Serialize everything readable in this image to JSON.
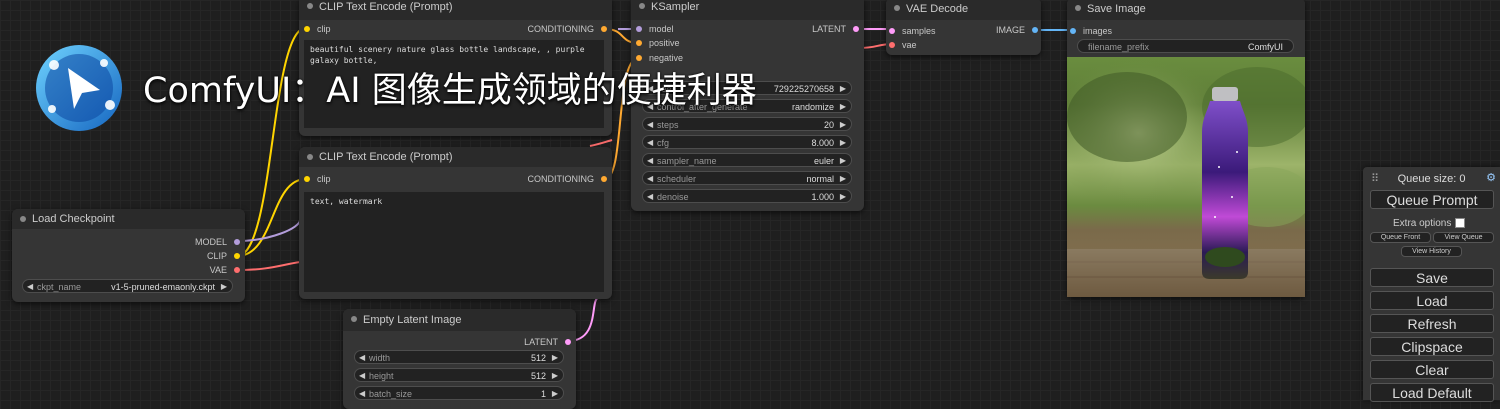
{
  "title": "ComfyUI：AI 图像生成领域的便捷利器",
  "colors": {
    "clip": "#ffd500",
    "model": "#b39ddb",
    "vae": "#ff6e6e",
    "conditioning": "#ffa931",
    "latent": "#ff9cf9",
    "image": "#64b5f6",
    "canvas": "#1f1f1f"
  },
  "nodes": {
    "load_checkpoint": {
      "title": "Load Checkpoint",
      "outputs": [
        "MODEL",
        "CLIP",
        "VAE"
      ],
      "ckpt_label": "ckpt_name",
      "ckpt_value": "v1-5-pruned-emaonly.ckpt"
    },
    "clip_pos": {
      "title": "CLIP Text Encode (Prompt)",
      "input": "clip",
      "output": "CONDITIONING",
      "text": "beautiful scenery nature glass bottle landscape, , purple galaxy bottle,"
    },
    "clip_neg": {
      "title": "CLIP Text Encode (Prompt)",
      "input": "clip",
      "output": "CONDITIONING",
      "text": "text, watermark"
    },
    "ksampler": {
      "title": "KSampler",
      "inputs": [
        "model",
        "positive",
        "negative"
      ],
      "output": "LATENT",
      "widgets": [
        {
          "label": "seed",
          "value": "729225270658"
        },
        {
          "label": "control_after_generate",
          "value": "randomize"
        },
        {
          "label": "steps",
          "value": "20"
        },
        {
          "label": "cfg",
          "value": "8.000"
        },
        {
          "label": "sampler_name",
          "value": "euler"
        },
        {
          "label": "scheduler",
          "value": "normal"
        },
        {
          "label": "denoise",
          "value": "1.000"
        }
      ]
    },
    "vae_decode": {
      "title": "VAE Decode",
      "inputs": [
        "samples",
        "vae"
      ],
      "output": "IMAGE"
    },
    "save_image": {
      "title": "Save Image",
      "input": "images",
      "prefix_label": "filename_prefix",
      "prefix_value": "ComfyUI"
    },
    "empty_latent": {
      "title": "Empty Latent Image",
      "output": "LATENT",
      "widgets": [
        {
          "label": "width",
          "value": "512"
        },
        {
          "label": "height",
          "value": "512"
        },
        {
          "label": "batch_size",
          "value": "1"
        }
      ]
    }
  },
  "panel": {
    "queue_size": "Queue size: 0",
    "queue_prompt": "Queue Prompt",
    "extra_options": "Extra options",
    "queue_front": "Queue Front",
    "view_queue": "View Queue",
    "view_history": "View History",
    "save": "Save",
    "load": "Load",
    "refresh": "Refresh",
    "clipspace": "Clipspace",
    "clear": "Clear",
    "load_default": "Load Default"
  }
}
